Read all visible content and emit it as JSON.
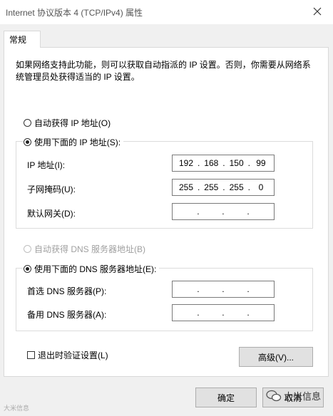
{
  "window": {
    "title": "Internet 协议版本 4 (TCP/IPv4) 属性"
  },
  "tabs": [
    {
      "label": "常规"
    }
  ],
  "description": "如果网络支持此功能，则可以获取自动指派的 IP 设置。否则，你需要从网络系统管理员处获得适当的 IP 设置。",
  "ip_section": {
    "auto_label": "自动获得 IP 地址(O)",
    "manual_label": "使用下面的 IP 地址(S):",
    "fields": [
      {
        "label": "IP 地址(I):",
        "octets": [
          "192",
          "168",
          "150",
          "99"
        ]
      },
      {
        "label": "子网掩码(U):",
        "octets": [
          "255",
          "255",
          "255",
          "0"
        ]
      },
      {
        "label": "默认网关(D):",
        "octets": [
          "",
          "",
          "",
          ""
        ]
      }
    ]
  },
  "dns_section": {
    "auto_label": "自动获得 DNS 服务器地址(B)",
    "manual_label": "使用下面的 DNS 服务器地址(E):",
    "fields": [
      {
        "label": "首选 DNS 服务器(P):",
        "octets": [
          "",
          "",
          "",
          ""
        ]
      },
      {
        "label": "备用 DNS 服务器(A):",
        "octets": [
          "",
          "",
          "",
          ""
        ]
      }
    ]
  },
  "validate_label": "退出时验证设置(L)",
  "buttons": {
    "advanced": "高级(V)...",
    "ok": "确定",
    "cancel": "取消"
  },
  "watermark": {
    "right": "大米信息",
    "left": "大米信息"
  },
  "icons": {
    "close": "close-icon",
    "watermark": "wechat-icon"
  }
}
